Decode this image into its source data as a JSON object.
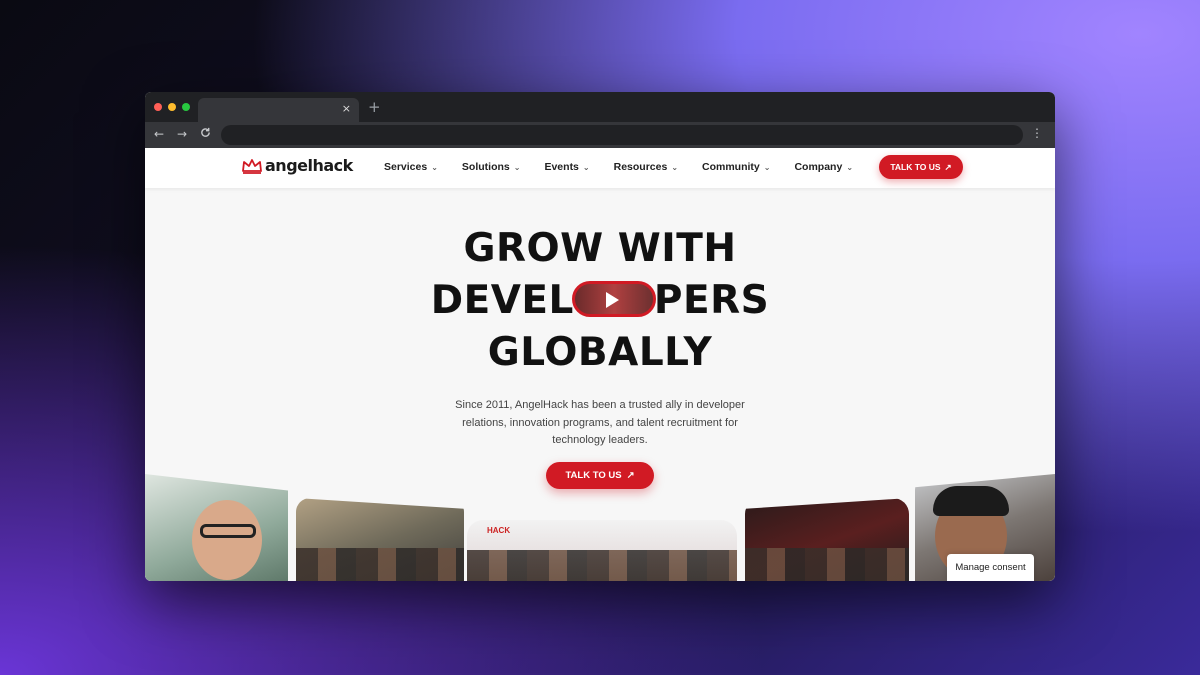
{
  "browser": {
    "tab_close": "×",
    "new_tab": "+",
    "back": "←",
    "forward": "→",
    "reload": "C",
    "menu": "⋮"
  },
  "site": {
    "logo_text": "angelhack",
    "nav": [
      {
        "label": "Services"
      },
      {
        "label": "Solutions"
      },
      {
        "label": "Events"
      },
      {
        "label": "Resources"
      },
      {
        "label": "Community"
      },
      {
        "label": "Company"
      }
    ],
    "nav_cta": "TALK TO US",
    "arrow": "↗",
    "chevron": "⌄"
  },
  "hero": {
    "line1": "GROW WITH",
    "line2_before": "DEVEL",
    "line2_after": "PERS",
    "line3": "GLOBALLY",
    "subtitle": "Since 2011, AngelHack has been a trusted ally in developer relations, innovation programs, and talent recruitment for technology leaders.",
    "cta": "TALK TO US"
  },
  "photos": {
    "banner_text": "HACK"
  },
  "consent": {
    "label": "Manage consent"
  },
  "colors": {
    "brand_red": "#d11a24",
    "chrome_dark": "#202124"
  }
}
